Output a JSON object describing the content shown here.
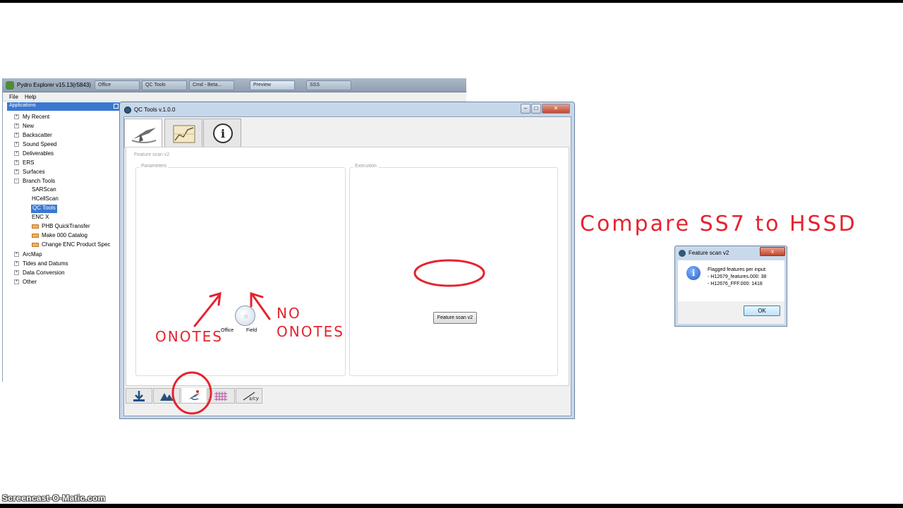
{
  "pydro": {
    "title": "Pydro Explorer v15.13(r5843)",
    "taskbar": [
      "Office",
      "QC Tools",
      "Cmd - Beta...",
      "Preview",
      "SSS"
    ],
    "menu": [
      "File",
      "Help"
    ],
    "panel_title": "Applications",
    "tree": [
      {
        "label": "My Recent",
        "expander": "+"
      },
      {
        "label": "New",
        "expander": "+"
      },
      {
        "label": "Backscatter",
        "expander": "+"
      },
      {
        "label": "Sound Speed",
        "expander": "+"
      },
      {
        "label": "Deliverables",
        "expander": "+"
      },
      {
        "label": "ERS",
        "expander": "+"
      },
      {
        "label": "Surfaces",
        "expander": "+"
      },
      {
        "label": "Branch Tools",
        "expander": "-"
      },
      {
        "label": "SARScan"
      },
      {
        "label": "HCellScan"
      },
      {
        "label": "QC Tools",
        "selected": true
      },
      {
        "label": "ENC X"
      },
      {
        "label": "PHB QuickTransfer",
        "icon": "folder-icon"
      },
      {
        "label": "Make 000 Catalog",
        "icon": "folder-icon"
      },
      {
        "label": "Change ENC Product Spec",
        "icon": "folder-icon"
      },
      {
        "label": "ArcMap",
        "expander": "+"
      },
      {
        "label": "Tides and Datums",
        "expander": "+"
      },
      {
        "label": "Data Conversion",
        "expander": "+"
      },
      {
        "label": "Other",
        "expander": "+"
      }
    ]
  },
  "qc_tools": {
    "title": "QC Tools v.1.0.0",
    "top_tabs": [
      "survey-tool-icon",
      "chart-graph-icon",
      "info-icon"
    ],
    "pane_title": "Feature scan v2",
    "parameters_title": "Parameters",
    "execution_title": "Execution",
    "option_office": "Office",
    "option_field": "Field",
    "run_button": "Feature scan v2",
    "bottom_tabs": [
      "download-icon",
      "surface-icon",
      "feature-scan-icon",
      "grid-icon",
      "slope-icon"
    ],
    "slope_tab_text": "s/cy"
  },
  "dialog": {
    "title": "Feature scan v2",
    "close": "x",
    "message_header": "Flagged features per input:",
    "lines": [
      "- H12679_features.000: 38",
      "- H12676_FFF.000: 1418"
    ],
    "ok": "OK",
    "info_glyph": "i"
  },
  "annotations": {
    "heading": "Compare SS7 to HSSD",
    "onotes": "ONOTES",
    "no": "NO",
    "no_onotes": "ONOTES",
    "color": "#e5232f"
  },
  "watermark": "Screencast-O-Matic.com"
}
